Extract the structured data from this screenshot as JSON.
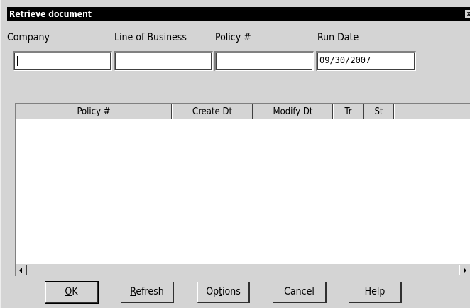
{
  "window": {
    "title": "Retrieve document",
    "close_glyph": "x"
  },
  "fields": {
    "company": {
      "label": "Company",
      "value": ""
    },
    "line_of_business": {
      "label": "Line of Business",
      "value": ""
    },
    "policy": {
      "label": "Policy #",
      "value": ""
    },
    "run_date": {
      "label": "Run Date",
      "value": "09/30/2007"
    }
  },
  "table": {
    "columns": [
      "Policy #",
      "Create Dt",
      "Modify Dt",
      "Tr",
      "St",
      ""
    ],
    "rows": []
  },
  "buttons": {
    "ok": {
      "mnemonic": "O",
      "rest": "K"
    },
    "refresh": {
      "mnemonic": "R",
      "rest": "efresh"
    },
    "options": {
      "pre": "Op",
      "mnemonic": "t",
      "rest": "ions"
    },
    "cancel": {
      "label": "Cancel"
    },
    "help": {
      "label": "Help"
    }
  },
  "icons": {
    "close": "close-icon",
    "scroll_left": "left-arrow-icon",
    "scroll_right": "right-arrow-icon"
  }
}
